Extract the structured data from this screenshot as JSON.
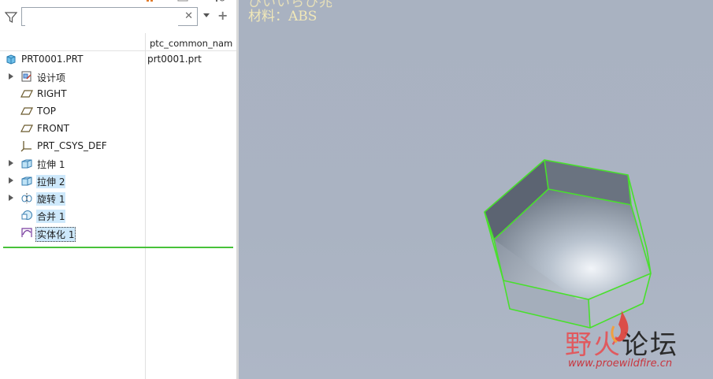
{
  "search": {
    "value": "",
    "placeholder": ""
  },
  "columns": {
    "name": "",
    "common_name": "ptc_common_name"
  },
  "tree": [
    {
      "label": "PRT0001.PRT",
      "value": "prt0001.prt"
    },
    {
      "label": "设计项"
    },
    {
      "label": "RIGHT"
    },
    {
      "label": "TOP"
    },
    {
      "label": "FRONT"
    },
    {
      "label": "PRT_CSYS_DEF"
    },
    {
      "label": "拉伸 1"
    },
    {
      "label": "拉伸 2"
    },
    {
      "label": "旋转 1"
    },
    {
      "label": "合并 1"
    },
    {
      "label": "实体化 1"
    }
  ],
  "viewport": {
    "material_label": "材料",
    "material_value": "ABS",
    "top_text_partial": "ひいいらひ兆"
  },
  "watermark": {
    "part1": "野火",
    "part2": "论坛",
    "url": "www.proewildfire.cn"
  },
  "colors": {
    "selection": "#cde8fb",
    "edge_highlight": "#48e02c",
    "info_text": "#f1e8b8",
    "watermark_red": "#d8323c"
  }
}
